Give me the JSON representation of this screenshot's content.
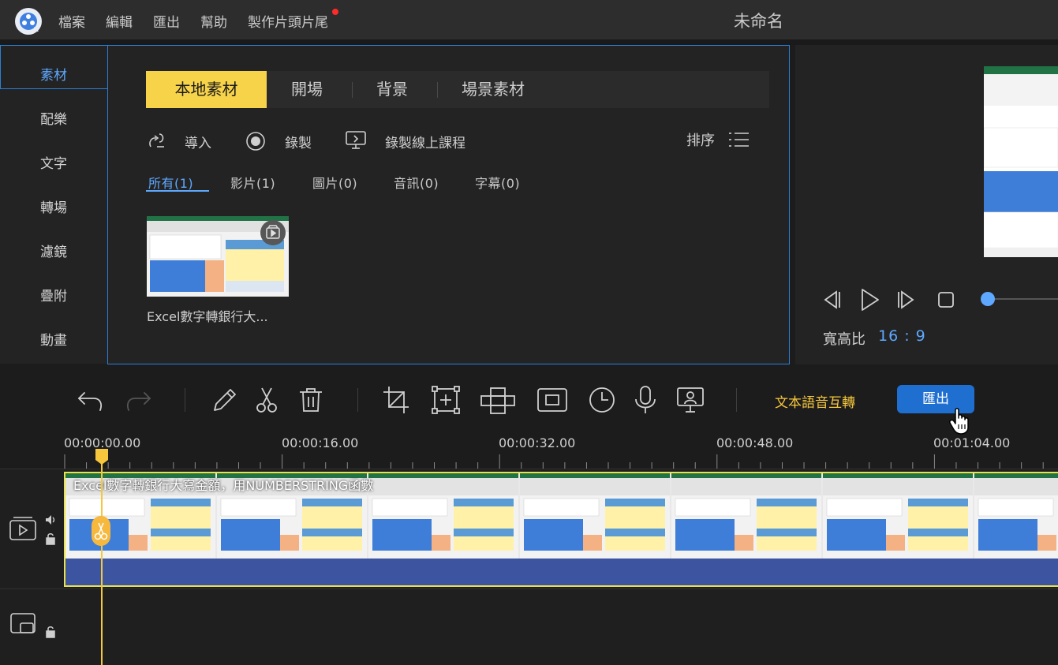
{
  "app": {
    "title": "未命名",
    "menu": [
      "檔案",
      "編輯",
      "匯出",
      "幫助",
      "製作片頭片尾"
    ]
  },
  "sidebar": {
    "items": [
      {
        "label": "素材",
        "active": true
      },
      {
        "label": "配樂"
      },
      {
        "label": "文字"
      },
      {
        "label": "轉場"
      },
      {
        "label": "濾鏡"
      },
      {
        "label": "疊附"
      },
      {
        "label": "動畫"
      }
    ]
  },
  "media": {
    "tabs": [
      {
        "label": "本地素材",
        "active": true
      },
      {
        "label": "開場"
      },
      {
        "label": "背景"
      },
      {
        "label": "場景素材"
      }
    ],
    "actions": {
      "import": "導入",
      "record": "錄製",
      "record_course": "錄製線上課程",
      "sort": "排序"
    },
    "filters": [
      {
        "label": "所有(1)",
        "active": true
      },
      {
        "label": "影片(1)"
      },
      {
        "label": "圖片(0)"
      },
      {
        "label": "音訊(0)"
      },
      {
        "label": "字幕(0)"
      }
    ],
    "items": [
      {
        "caption": "Excel數字轉銀行大..."
      }
    ]
  },
  "preview": {
    "aspect_label": "寬高比",
    "aspect_value": "16 : 9"
  },
  "toolbar": {
    "tts_label": "文本語音互轉",
    "export_label": "匯出"
  },
  "timeline": {
    "times": [
      "00:00:00.00",
      "00:00:16.00",
      "00:00:32.00",
      "00:00:48.00",
      "00:01:04.00"
    ],
    "clip_title": "Excel數字轉銀行大寫金額，用NUMBERSTRING函數"
  },
  "colors": {
    "accent_blue": "#2d7fd6",
    "accent_yellow": "#f6c73d",
    "export_button": "#1f6fd1",
    "background": "#1c1c1c"
  }
}
